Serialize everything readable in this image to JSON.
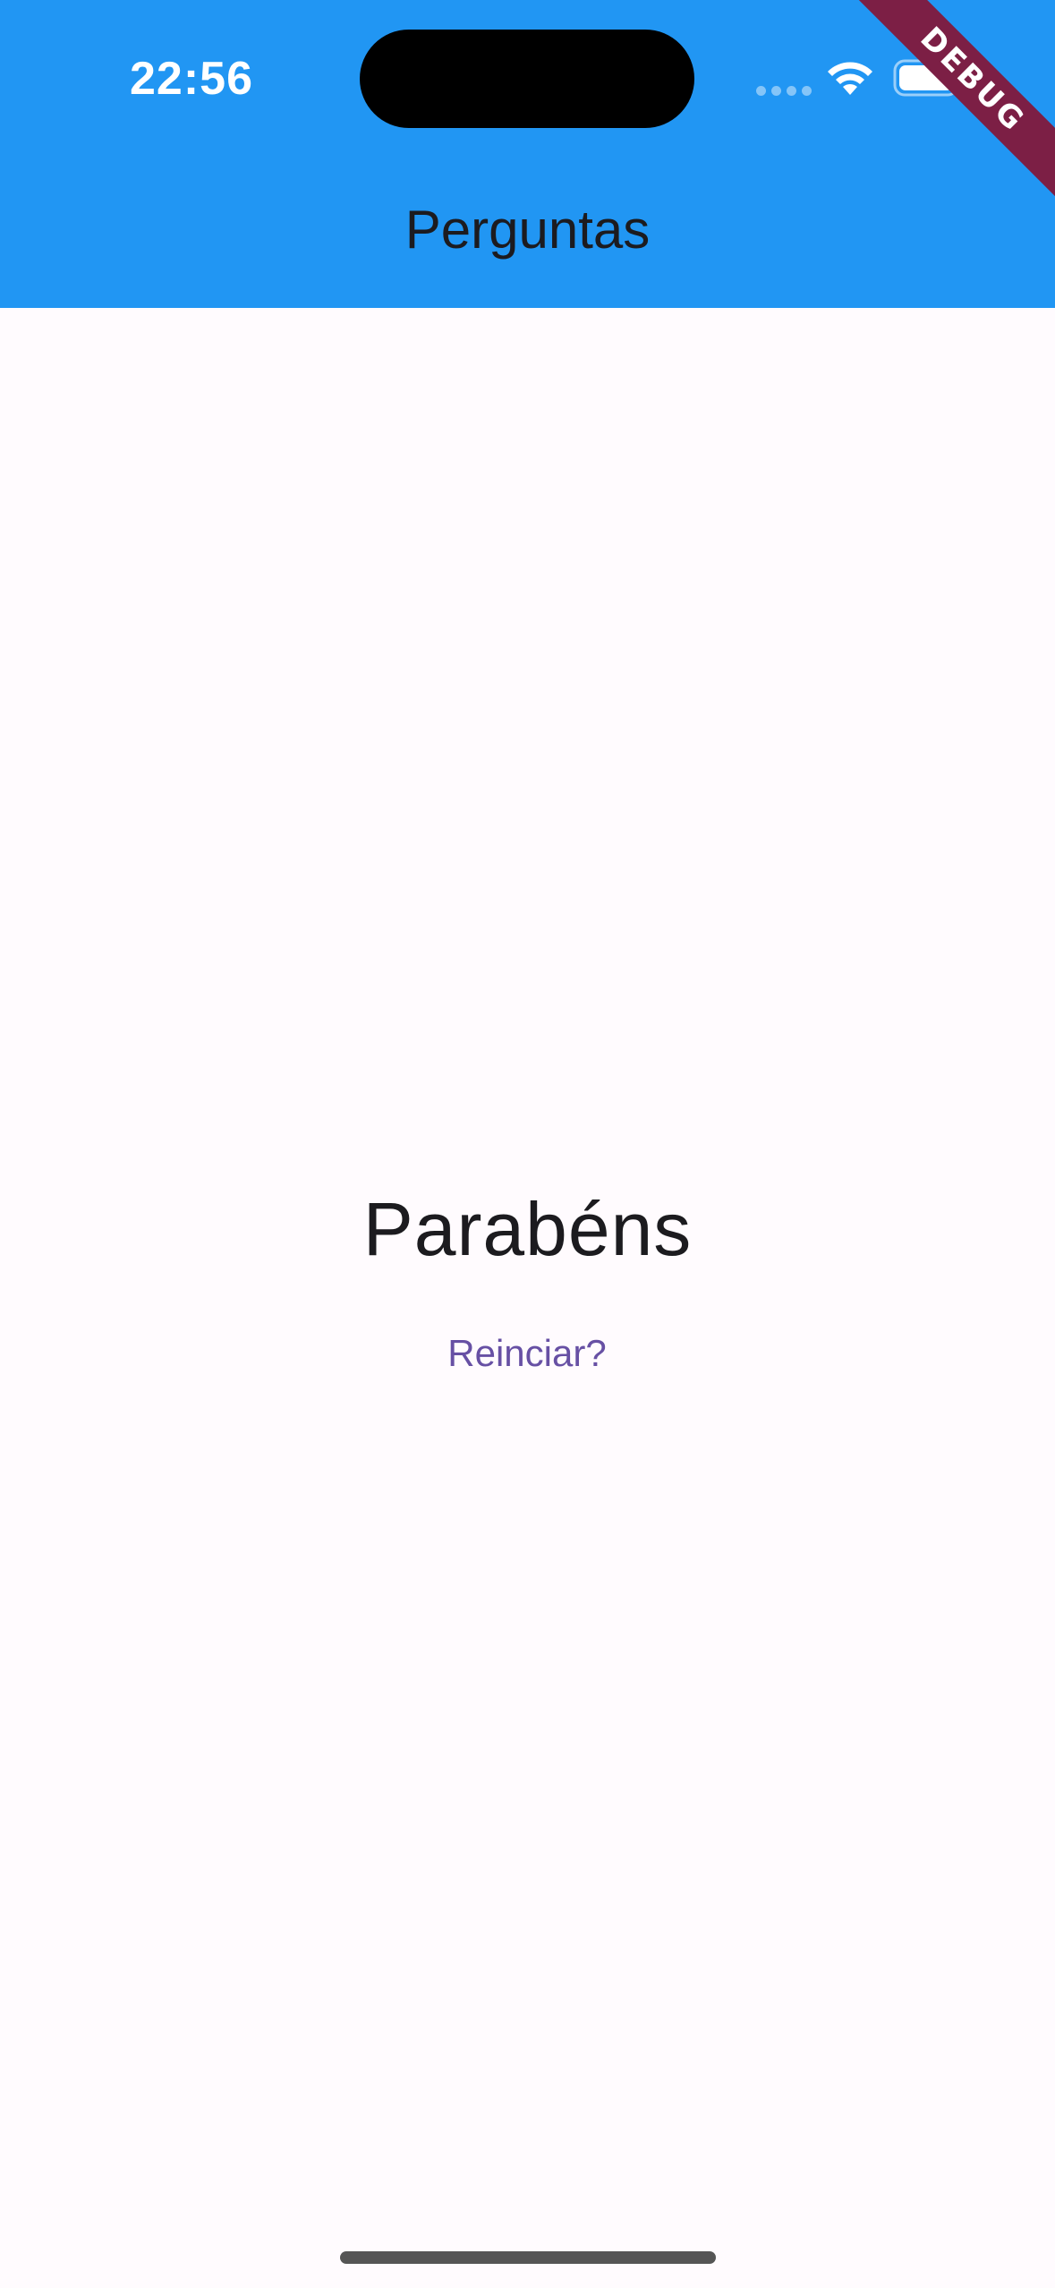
{
  "status_bar": {
    "time": "22:56",
    "wifi_icon": "wifi-icon",
    "battery_icon": "battery-icon"
  },
  "app_bar": {
    "title": "Perguntas",
    "background": "#2196F3"
  },
  "debug_banner": {
    "label": "DEBUG",
    "color": "#7C1F45"
  },
  "result": {
    "message": "Parabéns",
    "restart_label": "Reinciar?",
    "restart_color": "#6750A4"
  }
}
